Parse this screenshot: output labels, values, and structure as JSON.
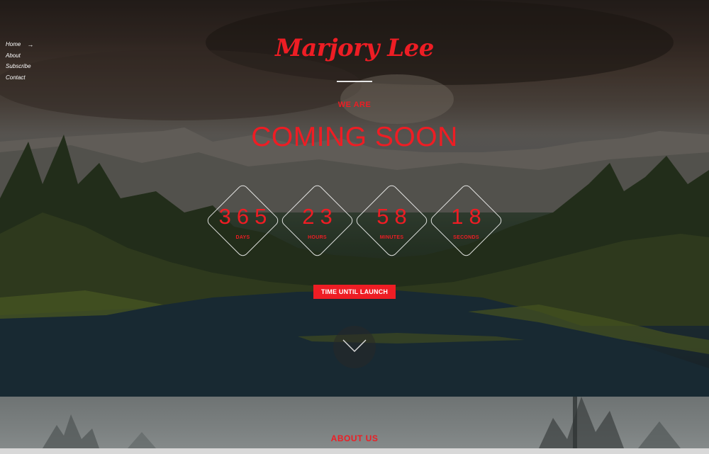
{
  "nav": {
    "items": [
      {
        "label": "Home"
      },
      {
        "label": "About"
      },
      {
        "label": "Subscribe"
      },
      {
        "label": "Contact"
      }
    ],
    "active_arrow": "→"
  },
  "brand": {
    "name": "Marjory Lee"
  },
  "hero": {
    "eyebrow": "WE ARE",
    "headline": "COMING SOON",
    "button_label": "TIME UNTIL LAUNCH"
  },
  "countdown": [
    {
      "value": "365",
      "label": "DAYS"
    },
    {
      "value": "23",
      "label": "HOURS"
    },
    {
      "value": "58",
      "label": "MINUTES"
    },
    {
      "value": "18",
      "label": "SECONDS"
    }
  ],
  "about": {
    "title": "ABOUT US"
  },
  "colors": {
    "accent": "#ee1d24",
    "text_light": "#ffffff"
  },
  "icons": {
    "scroll": "chevron-down-icon",
    "nav_active": "arrow-right-icon"
  }
}
